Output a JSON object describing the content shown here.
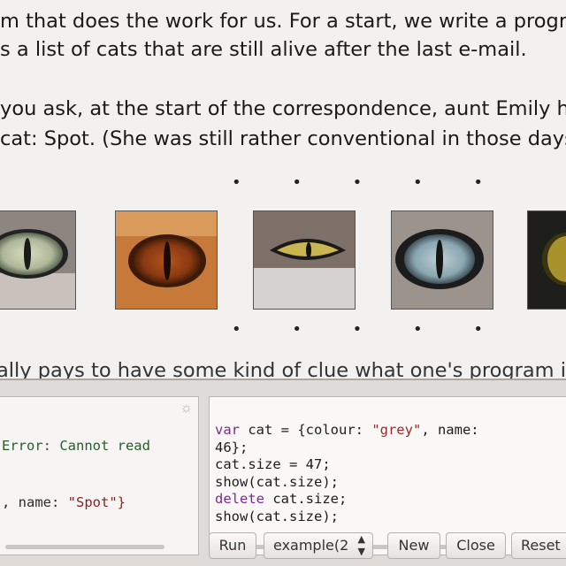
{
  "prose": {
    "line1": "m that does the work for us. For a start, we write a progran",
    "line2": "s a list of cats that are still alive after the last e-mail.",
    "line3": "you ask, at the start of the correspondence, aunt Emily hac",
    "line4": "cat: Spot. (She was still rather conventional in those days.)",
    "cutoff": "ally pays to have some kind of clue what one's program is go"
  },
  "separator": {
    "dots": "• • • • •"
  },
  "images": [
    {
      "name": "cat-eye-green"
    },
    {
      "name": "cat-eye-amber"
    },
    {
      "name": "cat-eye-yellow"
    },
    {
      "name": "cat-eye-blue"
    },
    {
      "name": "cat-eye-gold"
    }
  ],
  "console": {
    "output_error": "Error: Cannot read",
    "output_result_prefix": ", name: ",
    "output_result_value": "\"Spot\"}",
    "code": {
      "l1_kw": "var",
      "l1_a": " cat = {colour: ",
      "l1_str": "\"grey\"",
      "l1_b": ", name:",
      "l2": "46};",
      "l3": "cat.size = 47;",
      "l4": "show(cat.size);",
      "l5_kw": "delete",
      "l5_b": " cat.size;",
      "l6": "show(cat.size);"
    }
  },
  "toolbar": {
    "run": "Run",
    "example_select": "example(2",
    "new": "New",
    "close": "Close",
    "reset": "Reset"
  }
}
